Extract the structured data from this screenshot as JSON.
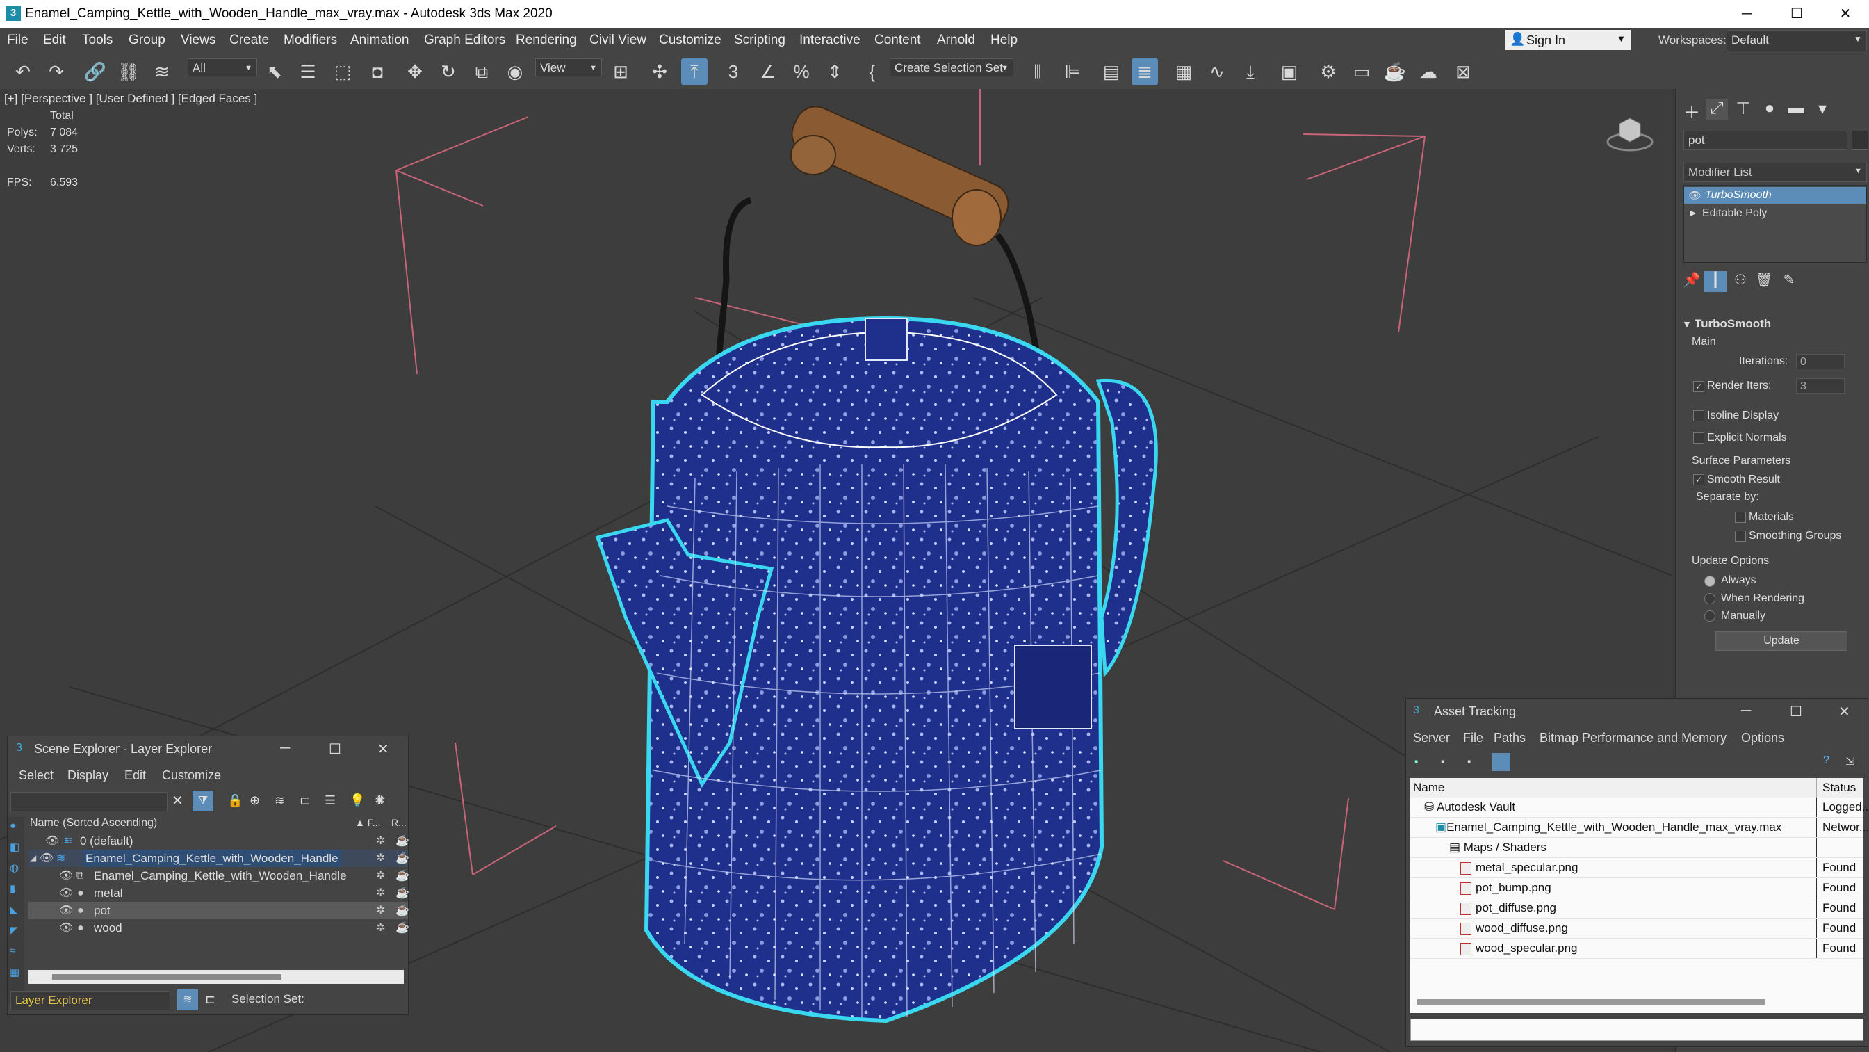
{
  "window": {
    "title": "Enamel_Camping_Kettle_with_Wooden_Handle_max_vray.max - Autodesk 3ds Max 2020",
    "icon": "3ds-max-logo"
  },
  "menu": [
    "File",
    "Edit",
    "Tools",
    "Group",
    "Views",
    "Create",
    "Modifiers",
    "Animation",
    "Graph Editors",
    "Rendering",
    "Civil View",
    "Customize",
    "Scripting",
    "Interactive",
    "Content",
    "Arnold",
    "Help"
  ],
  "account": {
    "sign_in": "Sign In",
    "workspaces_label": "Workspaces:",
    "workspace": "Default"
  },
  "toolbar": {
    "filter": "All",
    "ref_coord": "View",
    "selection_set": "Create Selection Set"
  },
  "viewport": {
    "label": "[+] [Perspective ] [User Defined ] [Edged Faces ]",
    "stats": {
      "total_label": "Total",
      "polys_label": "Polys:",
      "polys": "7 084",
      "verts_label": "Verts:",
      "verts": "3 725",
      "fps_label": "FPS:",
      "fps": "6.593"
    }
  },
  "command_panel": {
    "search": "pot",
    "modifier_list": "Modifier List",
    "stack": [
      "TurboSmooth",
      "Editable Poly"
    ],
    "rollout_title": "TurboSmooth",
    "main_label": "Main",
    "iterations_label": "Iterations:",
    "iterations": "0",
    "render_iters_label": "Render Iters:",
    "render_iters": "3",
    "isoline": "Isoline Display",
    "explicit_normals": "Explicit Normals",
    "surface_params": "Surface Parameters",
    "smooth_result": "Smooth Result",
    "separate_by": "Separate by:",
    "materials": "Materials",
    "smoothing_groups": "Smoothing Groups",
    "update_options": "Update Options",
    "always": "Always",
    "when_rendering": "When Rendering",
    "manually": "Manually",
    "update": "Update"
  },
  "scene_explorer": {
    "title": "Scene Explorer - Layer Explorer",
    "menu": [
      "Select",
      "Display",
      "Edit",
      "Customize"
    ],
    "col_name": "Name (Sorted Ascending)",
    "col_f": "▲ F...",
    "col_r": "R...",
    "rows": [
      {
        "name": "0 (default)"
      },
      {
        "name": "Enamel_Camping_Kettle_with_Wooden_Handle"
      },
      {
        "name": "Enamel_Camping_Kettle_with_Wooden_Handle"
      },
      {
        "name": "metal"
      },
      {
        "name": "pot"
      },
      {
        "name": "wood"
      }
    ],
    "footer_mode": "Layer Explorer",
    "selection_set_label": "Selection Set:"
  },
  "asset_tracking": {
    "title": "Asset Tracking",
    "menu": [
      "Server",
      "File",
      "Paths",
      "Bitmap Performance and Memory",
      "Options"
    ],
    "col_name": "Name",
    "col_status": "Status",
    "rows": [
      {
        "name": "Autodesk Vault",
        "status": "Logged..."
      },
      {
        "name": "Enamel_Camping_Kettle_with_Wooden_Handle_max_vray.max",
        "status": "Networ..."
      },
      {
        "name": "Maps / Shaders",
        "status": ""
      },
      {
        "name": "metal_specular.png",
        "status": "Found"
      },
      {
        "name": "pot_bump.png",
        "status": "Found"
      },
      {
        "name": "pot_diffuse.png",
        "status": "Found"
      },
      {
        "name": "wood_diffuse.png",
        "status": "Found"
      },
      {
        "name": "wood_specular.png",
        "status": "Found"
      }
    ]
  },
  "colors": {
    "accent": "#5b8db8",
    "selection_cyan": "#3ad8f0",
    "enamel_blue": "#1e2f8c"
  }
}
